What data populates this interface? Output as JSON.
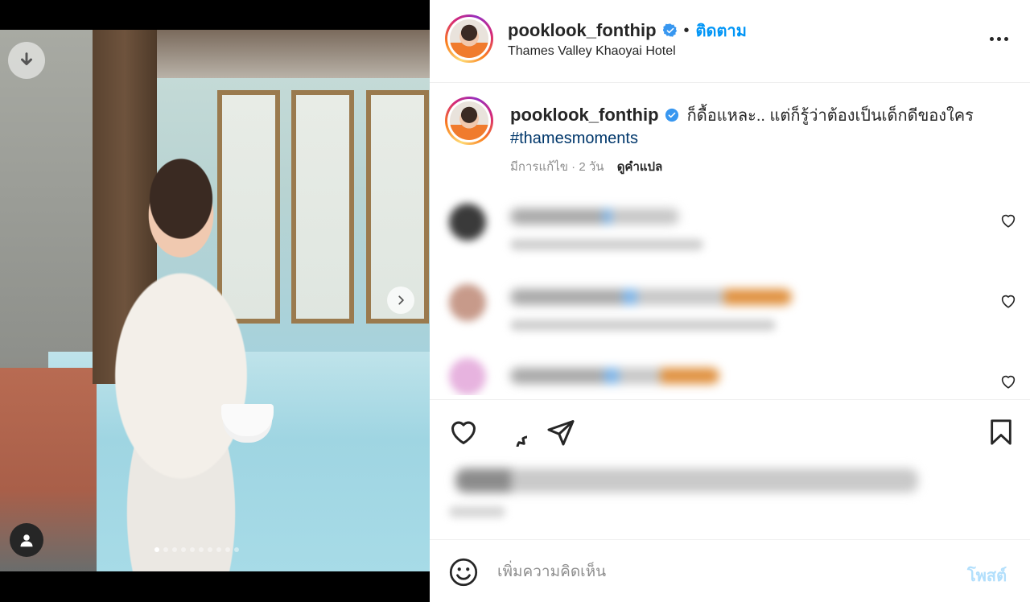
{
  "post": {
    "username": "pooklook_fonthip",
    "follow_label": "ติดตาม",
    "separator": "•",
    "location": "Thames Valley Khaoyai Hotel"
  },
  "caption": {
    "username": "pooklook_fonthip",
    "text": "ก็ดื้อแหละ.. แต่ก็รู้ว่าต้องเป็นเด็กดีของใคร",
    "hashtag": "#thamesmoments",
    "meta": "มีการแก้ไข · 2 วัน",
    "translate_label": "ดูคำแปล"
  },
  "media": {
    "carousel_count": 10,
    "active_index": 0
  },
  "comments": [
    {
      "avatar_color": "#3a3a3a",
      "blurred": true
    },
    {
      "avatar_color": "#c79a8a",
      "blurred": true
    },
    {
      "avatar_color": "#e7b3df",
      "blurred": true
    }
  ],
  "add_comment": {
    "placeholder": "เพิ่มความคิดเห็น",
    "post_label": "โพสต์"
  },
  "colors": {
    "accent": "#0095f6",
    "post_disabled": "#b2dffc",
    "hashtag": "#00376b",
    "muted": "#8e8e8e"
  },
  "icons": [
    "download-icon",
    "chevron-right-icon",
    "user-icon",
    "verified-badge-icon",
    "more-icon",
    "heart-icon",
    "comment-icon",
    "share-icon",
    "bookmark-icon",
    "emoji-icon"
  ]
}
